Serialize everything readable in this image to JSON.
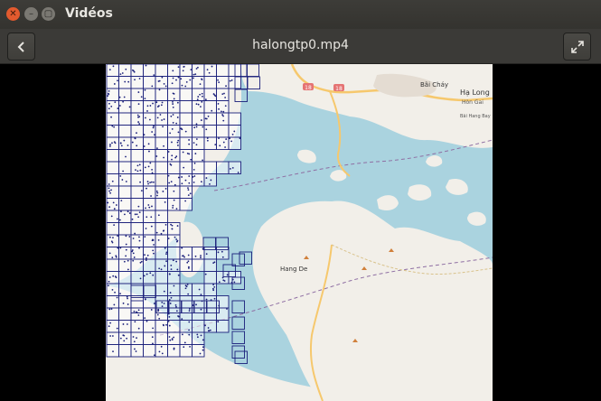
{
  "window": {
    "app_title": "Vidéos",
    "controls": {
      "close_glyph": "✕",
      "minimize_glyph": "–",
      "maximize_glyph": "▢"
    }
  },
  "header": {
    "file_title": "halongtp0.mp4",
    "back_icon": "chevron-left-icon",
    "fullscreen_icon": "fullscreen-icon"
  },
  "map": {
    "labels": [
      "Bãi Cháy",
      "Hạ Long",
      "Hòn Gai",
      "Bãi Hang Bay",
      "Hang De"
    ],
    "road_shields": [
      "18",
      "18"
    ],
    "colors": {
      "water": "#aad3df",
      "land": "#f2efe9",
      "grid": "#1a1f7a",
      "road": "#f6c86d"
    }
  }
}
